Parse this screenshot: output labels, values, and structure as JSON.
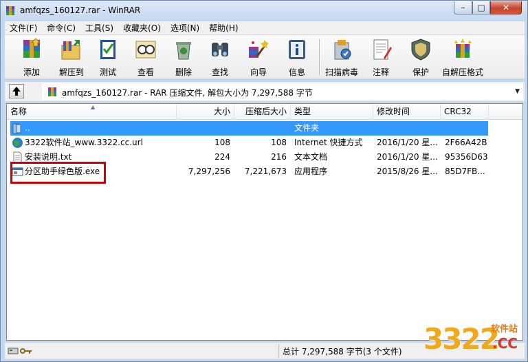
{
  "window": {
    "title": "amfqzs_160127.rar - WinRAR",
    "controls": {
      "minimize": "–",
      "maximize": "□",
      "close": "✕"
    }
  },
  "menu": [
    "文件(F)",
    "命令(C)",
    "工具(S)",
    "收藏夹(O)",
    "选项(N)",
    "帮助(H)"
  ],
  "toolbar": [
    {
      "label": "添加",
      "icon": "add-archive-icon"
    },
    {
      "label": "解压到",
      "icon": "extract-to-icon"
    },
    {
      "label": "测试",
      "icon": "test-icon"
    },
    {
      "label": "查看",
      "icon": "view-icon"
    },
    {
      "label": "删除",
      "icon": "delete-icon"
    },
    {
      "label": "查找",
      "icon": "find-icon"
    },
    {
      "label": "向导",
      "icon": "wizard-icon"
    },
    {
      "label": "信息",
      "icon": "info-icon"
    },
    {
      "label": "扫描病毒",
      "icon": "virus-scan-icon"
    },
    {
      "label": "注释",
      "icon": "comment-icon"
    },
    {
      "label": "保护",
      "icon": "protect-icon"
    },
    {
      "label": "自解压格式",
      "icon": "sfx-icon"
    }
  ],
  "address": {
    "text": "amfqzs_160127.rar - RAR 压缩文件, 解包大小为 7,297,588 字节",
    "dropdown_icon": "chevron-down-icon",
    "up_icon": "up-folder-icon"
  },
  "columns": [
    "名称",
    "大小",
    "压缩后大小",
    "类型",
    "修改时间",
    "CRC32"
  ],
  "files": [
    {
      "name": "..",
      "size": "",
      "packed": "",
      "type": "文件夹",
      "modified": "",
      "crc": "",
      "icon": "folder-icon",
      "selected": true
    },
    {
      "name": "3322软件站_www.3322.cc.url",
      "size": "108",
      "packed": "108",
      "type": "Internet 快捷方式",
      "modified": "2016/1/20 星...",
      "crc": "2F66A42B",
      "icon": "globe-icon",
      "selected": false
    },
    {
      "name": "安装说明.txt",
      "size": "224",
      "packed": "216",
      "type": "文本文档",
      "modified": "2016/1/20 星...",
      "crc": "95356D63",
      "icon": "text-file-icon",
      "selected": false
    },
    {
      "name": "分区助手绿色版.exe",
      "size": "7,297,256",
      "packed": "7,221,673",
      "type": "应用程序",
      "modified": "2015/8/26 星...",
      "crc": "85D7FB...",
      "icon": "exe-file-icon",
      "selected": false
    }
  ],
  "status": {
    "text": "总计 7,297,588 字节(3 个文件)"
  },
  "watermark": {
    "number": "3322",
    "cn": "软件站",
    "cc": ".CC"
  },
  "colors": {
    "selection": "#3399ff",
    "highlight_box": "#d00000",
    "title_bar": "#c4d7ee"
  }
}
